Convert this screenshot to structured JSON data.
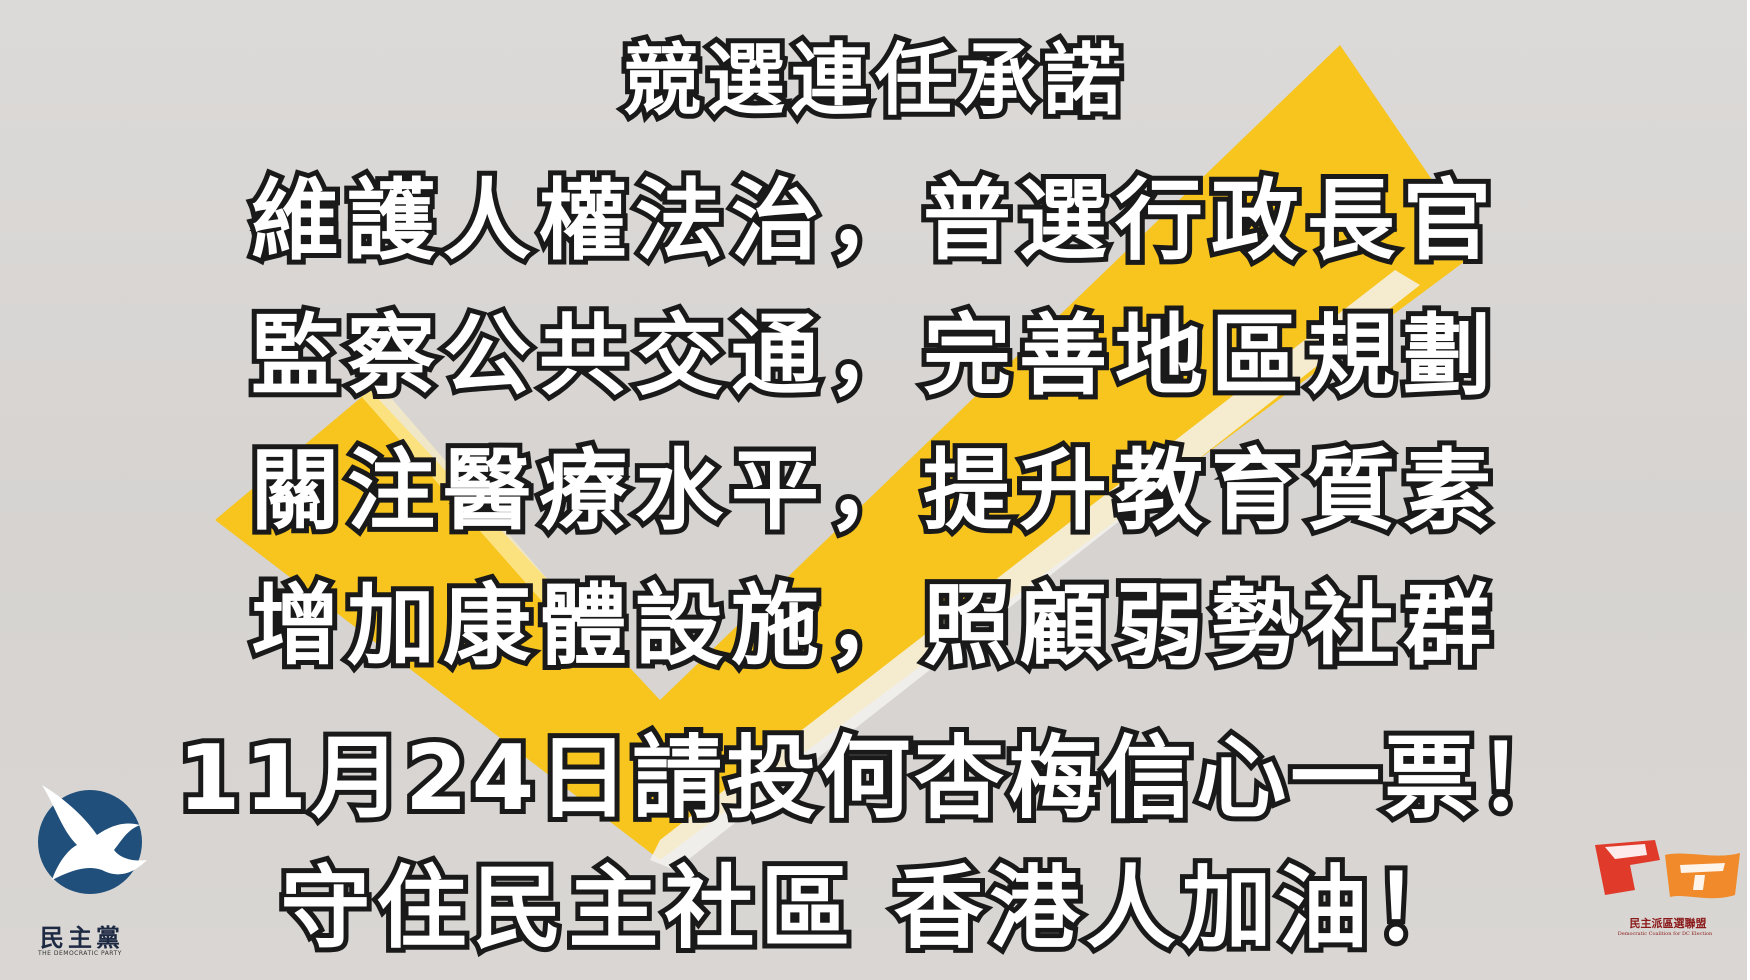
{
  "poster": {
    "title": "競選連任承諾",
    "lines": [
      "維護人權法治，普選行政長官",
      "監察公共交通，完善地區規劃",
      "關注醫療水平，提升教育質素",
      "增加康體設施，照顧弱勢社群"
    ],
    "vote_call": "11月24日請投何杏梅信心一票！",
    "slogan": "守住民主社區 香港人加油！"
  },
  "logos": {
    "left_name": "民主黨",
    "left_english": "THE DEMOCRATIC PARTY",
    "right_name": "民主派區選聯盟",
    "right_english": "Democratic Coalition for DC Election"
  },
  "colors": {
    "background": "#d8d5d2",
    "check_yellow": "#f7c51e",
    "text_fill": "#ffffff",
    "text_outline": "#1a1a1a",
    "dove_blue": "#1f4f7a",
    "coalition_red": "#e03a2a",
    "coalition_orange": "#f08a2a"
  },
  "icons": [
    "checkmark",
    "dove-logo",
    "coalition-flag-logo"
  ]
}
